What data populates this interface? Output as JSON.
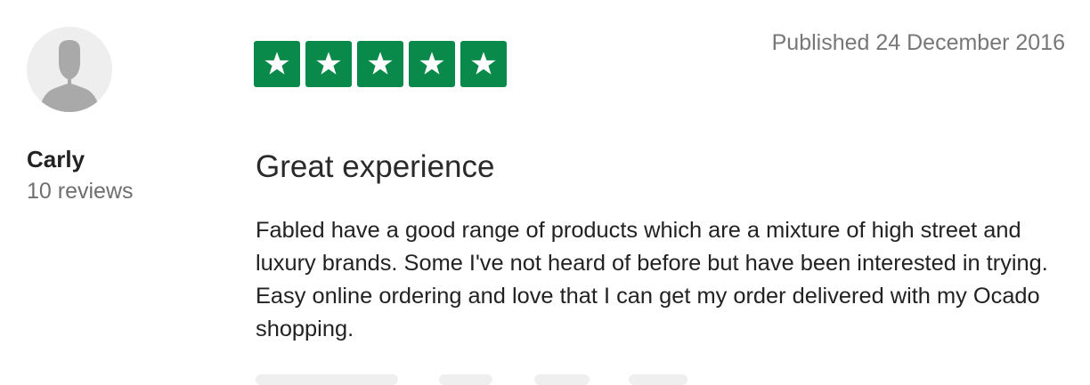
{
  "consumer": {
    "name": "Carly",
    "review_count": "10 reviews",
    "avatar_icon": "user-silhouette-icon"
  },
  "rating": {
    "value": 5,
    "max": 5,
    "star_icon": "star-icon",
    "color": "#0a8a4a"
  },
  "review": {
    "published": "Published 24 December 2016",
    "title": "Great experience",
    "body": "Fabled have a good range of products which are a mixture of high street and luxury brands. Some I've not heard of before but have been interested in trying. Easy online ordering and love that I can get my order delivered with my Ocado shopping."
  }
}
